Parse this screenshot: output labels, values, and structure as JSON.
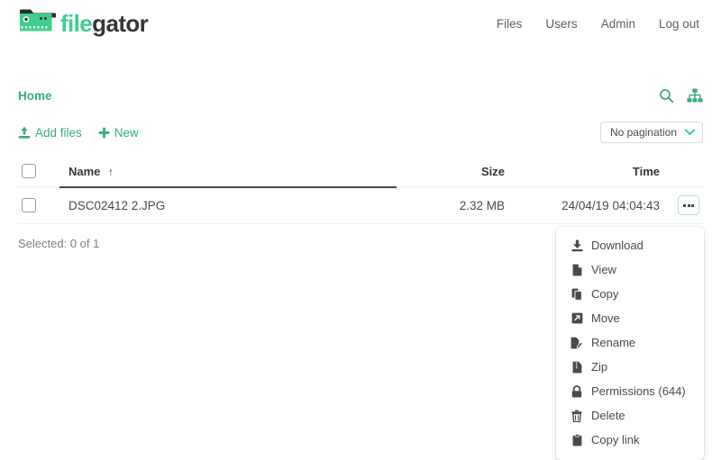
{
  "brand": {
    "word1": "file",
    "word2": "gator",
    "logo_icon": "filegator-folder-gator-logo",
    "green": "#3ecf8e",
    "dark": "#363636"
  },
  "nav": {
    "links": [
      {
        "label": "Files",
        "name": "nav-link-files"
      },
      {
        "label": "Users",
        "name": "nav-link-users"
      },
      {
        "label": "Admin",
        "name": "nav-link-admin"
      },
      {
        "label": "Log out",
        "name": "nav-link-log-out"
      }
    ]
  },
  "breadcrumb": {
    "home_label": "Home",
    "accent": "#3aab7f"
  },
  "crumb_tools": [
    {
      "icon": "search-icon",
      "name": "search-icon"
    },
    {
      "icon": "sitemap-icon",
      "name": "sitemap-icon"
    }
  ],
  "actions": {
    "add_files_label": "Add files",
    "add_files_icon": "upload-icon",
    "new_label": "New",
    "new_icon": "plus-icon"
  },
  "pagination": {
    "selected": "No pagination",
    "chevron_icon": "chevron-down-icon"
  },
  "table": {
    "columns": [
      {
        "label": "",
        "key": "check"
      },
      {
        "label": "Name",
        "key": "name",
        "sorted": true,
        "sort_icon": "arrow-up-icon"
      },
      {
        "label": "Size",
        "key": "size"
      },
      {
        "label": "Time",
        "key": "time"
      },
      {
        "label": "",
        "key": "actions"
      }
    ],
    "rows": [
      {
        "name": "DSC02412 2.JPG",
        "size": "2.32 MB",
        "time": "24/04/19 04:04:43",
        "dots_icon": "ellipsis-icon"
      }
    ]
  },
  "status": {
    "selected_text": "Selected: 0 of 1"
  },
  "context_menu": {
    "items": [
      {
        "label": "Download",
        "icon": "download-icon",
        "name": "menu-item-download"
      },
      {
        "label": "View",
        "icon": "file-icon",
        "name": "menu-item-view"
      },
      {
        "label": "Copy",
        "icon": "copy-icon",
        "name": "menu-item-copy"
      },
      {
        "label": "Move",
        "icon": "move-arrow-icon",
        "name": "menu-item-move"
      },
      {
        "label": "Rename",
        "icon": "file-pen-icon",
        "name": "menu-item-rename"
      },
      {
        "label": "Zip",
        "icon": "file-archive-icon",
        "name": "menu-item-zip"
      },
      {
        "label": "Permissions (644)",
        "icon": "lock-icon",
        "name": "menu-item-permissions"
      },
      {
        "label": "Delete",
        "icon": "trash-icon",
        "name": "menu-item-delete"
      },
      {
        "label": "Copy link",
        "icon": "clipboard-icon",
        "name": "menu-item-copy-link"
      }
    ]
  }
}
